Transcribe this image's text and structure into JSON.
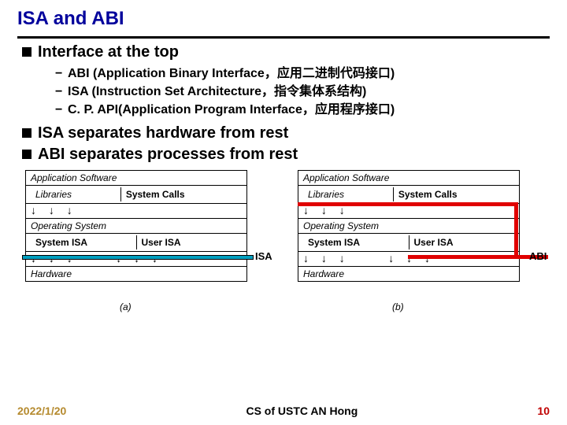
{
  "title": "ISA and ABI",
  "bullets": {
    "b1": "Interface at the top",
    "b1_subs": {
      "s1": "ABI (Application Binary Interface，应用二进制代码接口)",
      "s2": "ISA (Instruction Set Architecture，指令集体系结构)",
      "s3": "C. P. API(Application Program Interface，应用程序接口)"
    },
    "b2": "ISA separates hardware from rest",
    "b3": "ABI separates processes from rest"
  },
  "diagram": {
    "layers": {
      "app": "Application Software",
      "lib": "Libraries",
      "syscalls": "System Calls",
      "os": "Operating System",
      "sys_isa": "System ISA",
      "user_isa": "User ISA",
      "hw": "Hardware"
    },
    "labels": {
      "isa": "ISA",
      "abi": "ABI",
      "cap_a": "(a)",
      "cap_b": "(b)"
    }
  },
  "footer": {
    "date": "2022/1/20",
    "center": "CS of USTC AN Hong",
    "page": "10"
  }
}
